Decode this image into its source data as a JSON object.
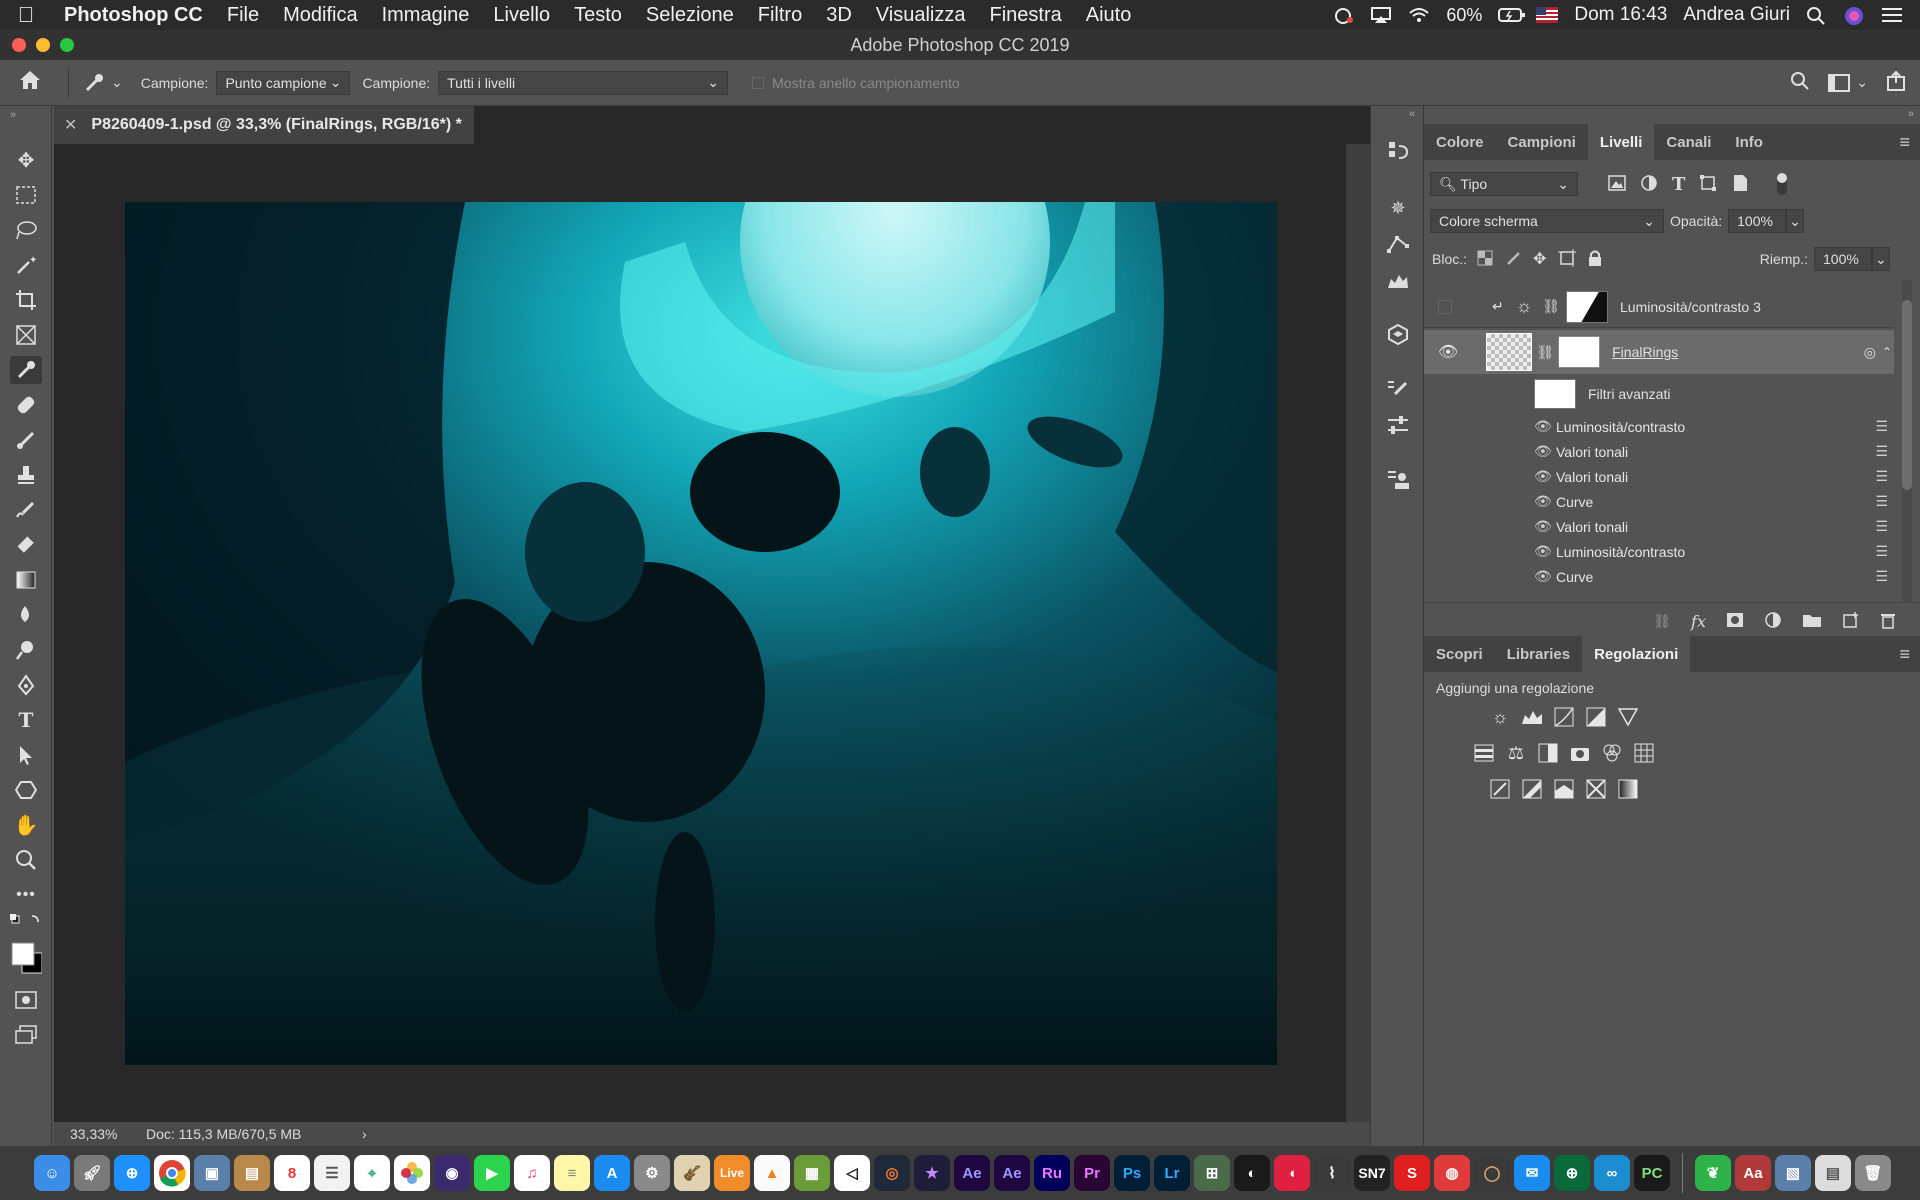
{
  "menubar": {
    "app_name": "Photoshop CC",
    "items": [
      "File",
      "Modifica",
      "Immagine",
      "Livello",
      "Testo",
      "Selezione",
      "Filtro",
      "3D",
      "Visualizza",
      "Finestra",
      "Aiuto"
    ],
    "battery": "60%",
    "clock": "Dom 16:43",
    "user": "Andrea Giuri"
  },
  "window": {
    "title": "Adobe Photoshop CC 2019"
  },
  "options": {
    "sample_label_1": "Campione:",
    "sample_value_1": "Punto campione",
    "sample_label_2": "Campione:",
    "sample_value_2": "Tutti i livelli",
    "ring_label": "Mostra anello campionamento"
  },
  "document": {
    "tab_title": "P8260409-1.psd @ 33,3% (FinalRings, RGB/16*) *",
    "zoom": "33,33%",
    "doc_info": "Doc: 115,3 MB/670,5 MB"
  },
  "layers_panel": {
    "tabs": [
      "Colore",
      "Campioni",
      "Livelli",
      "Canali",
      "Info"
    ],
    "active_tab": "Livelli",
    "filter_kind": "Tipo",
    "blend_mode": "Colore scherma",
    "opacity_label": "Opacità:",
    "opacity_value": "100%",
    "lock_label": "Bloc.:",
    "fill_label": "Riemp.:",
    "fill_value": "100%",
    "layers": [
      {
        "name": "Luminosità/contrasto 3"
      },
      {
        "name": "FinalRings"
      }
    ],
    "smart_filters_label": "Filtri avanzati",
    "smart_filters": [
      "Luminosità/contrasto",
      "Valori tonali",
      "Valori tonali",
      "Curve",
      "Valori tonali",
      "Luminosità/contrasto",
      "Curve"
    ]
  },
  "adjust_panel": {
    "tabs": [
      "Scopri",
      "Libraries",
      "Regolazioni"
    ],
    "active_tab": "Regolazioni",
    "heading": "Aggiungi una regolazione"
  },
  "dock": {
    "apps": [
      "Ae",
      "Ae",
      "Ru",
      "Pr",
      "Ps",
      "Lr",
      "SN7",
      "PC",
      "Live"
    ]
  },
  "colors": {
    "ps_blue": "#31a8ff",
    "ae_purple": "#9999ff",
    "pr_purple": "#9999ff",
    "lr_blue": "#31a8ff"
  }
}
